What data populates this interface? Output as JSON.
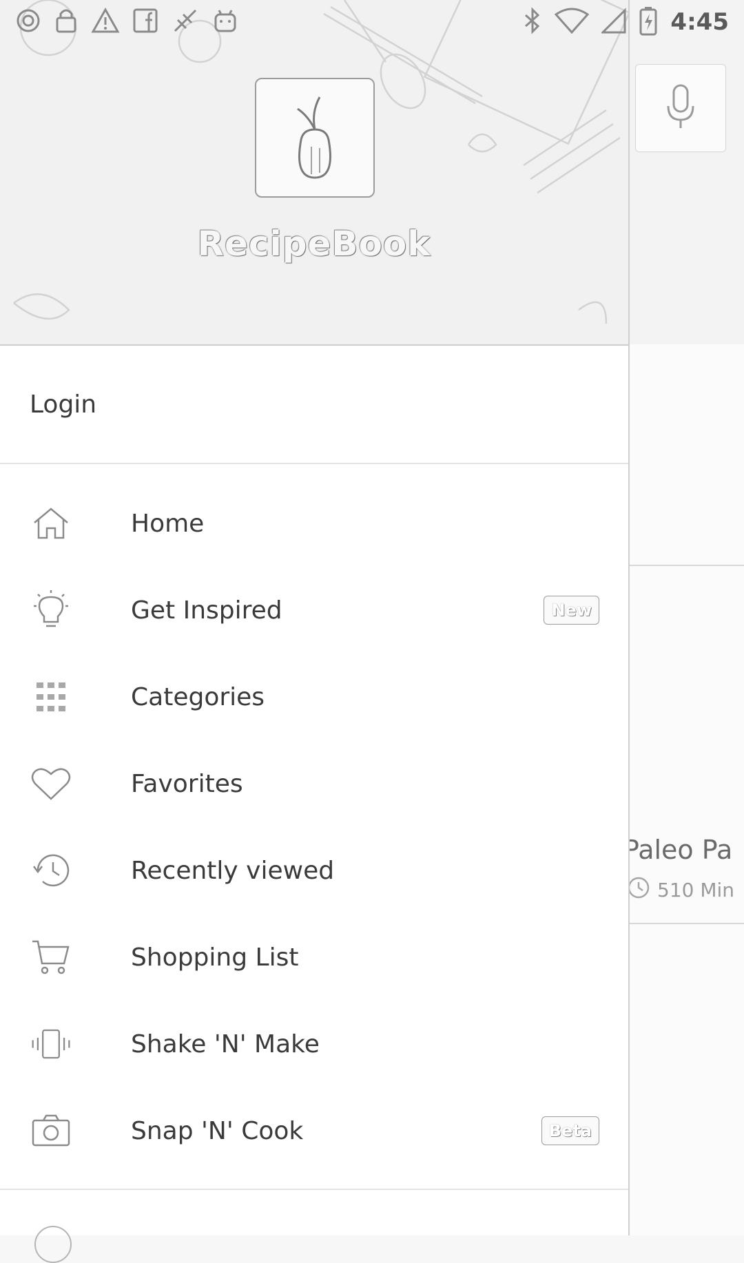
{
  "status_bar": {
    "time": "4:45",
    "left_icons": [
      "circle-notification-icon",
      "lock-icon",
      "warning-icon",
      "facebook-icon",
      "fax-icon",
      "android-icon"
    ],
    "right_icons": [
      "bluetooth-icon",
      "wifi-icon",
      "signal-icon",
      "battery-charging-icon"
    ]
  },
  "drawer": {
    "app_name": "RecipeBook",
    "login_label": "Login",
    "items": [
      {
        "label": "Home",
        "icon": "home-icon"
      },
      {
        "label": "Get Inspired",
        "icon": "lightbulb-icon",
        "badge": "New"
      },
      {
        "label": "Categories",
        "icon": "grid-icon"
      },
      {
        "label": "Favorites",
        "icon": "heart-icon"
      },
      {
        "label": "Recently viewed",
        "icon": "history-icon"
      },
      {
        "label": "Shopping List",
        "icon": "cart-icon"
      },
      {
        "label": "Shake 'N' Make",
        "icon": "phone-vibrate-icon"
      },
      {
        "label": "Snap 'N' Cook",
        "icon": "camera-icon",
        "badge": "Beta"
      }
    ]
  },
  "background": {
    "card_title": "Paleo Pa",
    "card_meta": "510 Min"
  },
  "colors": {
    "drawer_bg": "#ffffff",
    "text": "#3a3a3a",
    "divider": "#e3e3e3"
  }
}
